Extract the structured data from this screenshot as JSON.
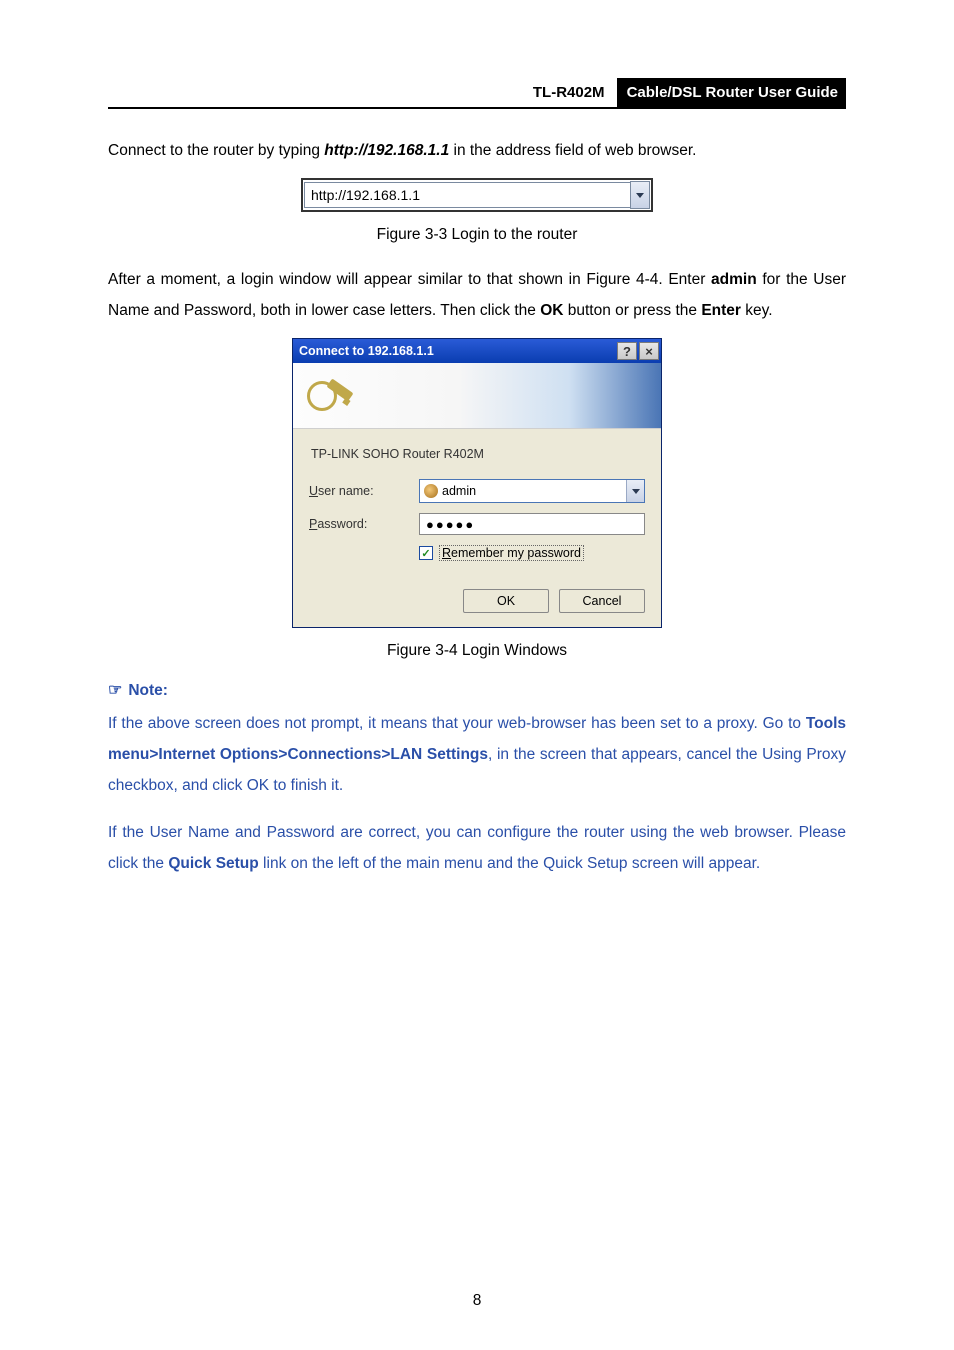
{
  "header": {
    "model": "TL-R402M",
    "guide": "Cable/DSL  Router  User  Guide"
  },
  "intro_para_pre": "Connect to the router by typing ",
  "intro_para_url": "http://192.168.1.1",
  "intro_para_post": " in the address field of web browser.",
  "addressbar": {
    "url": "http://192.168.1.1"
  },
  "fig33": "Figure 3-3 Login to the router",
  "after_para_1": "After a moment, a login window will appear similar to that shown in Figure 4-4. Enter ",
  "after_para_admin": "admin",
  "after_para_2": " for the User Name and Password, both in lower case letters. Then click the ",
  "after_para_ok": "OK",
  "after_para_3": " button or press the ",
  "after_para_enter": "Enter",
  "after_para_4": " key.",
  "dialog": {
    "title": "Connect to 192.168.1.1",
    "help": "?",
    "close": "×",
    "realm": "TP-LINK SOHO Router R402M",
    "user_label_initial": "U",
    "user_label_rest": "ser name:",
    "user_value": "admin",
    "pass_label_initial": "P",
    "pass_label_rest": "assword:",
    "pass_mask": "●●●●●",
    "remember_initial": "R",
    "remember_rest": "emember my password",
    "checked": "✓",
    "ok_btn": "OK",
    "cancel_btn": "Cancel"
  },
  "fig34": "Figure 3-4 Login Windows",
  "note_head": "Note:",
  "note_hand": "☞",
  "note1_pre": "If the above screen does not prompt, it means that your web-browser has been set to a proxy. Go to ",
  "note1_bold": "Tools menu>Internet Options>Connections>LAN Settings",
  "note1_post": ", in the screen that appears, cancel the Using Proxy checkbox, and click OK to finish it.",
  "note2_pre": "If the User Name and Password are correct, you can configure the router using the web browser. Please click the ",
  "note2_bold": "Quick Setup",
  "note2_post": " link on the left of the main menu and the Quick Setup screen will appear.",
  "page_number": "8"
}
